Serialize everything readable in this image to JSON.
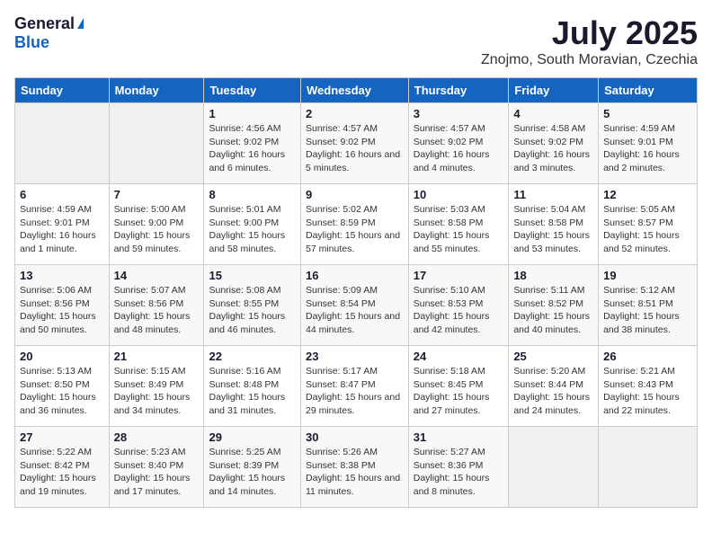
{
  "logo": {
    "general": "General",
    "blue": "Blue"
  },
  "title": "July 2025",
  "subtitle": "Znojmo, South Moravian, Czechia",
  "days_of_week": [
    "Sunday",
    "Monday",
    "Tuesday",
    "Wednesday",
    "Thursday",
    "Friday",
    "Saturday"
  ],
  "weeks": [
    [
      {
        "day": "",
        "sunrise": "",
        "sunset": "",
        "daylight": ""
      },
      {
        "day": "",
        "sunrise": "",
        "sunset": "",
        "daylight": ""
      },
      {
        "day": "1",
        "sunrise": "Sunrise: 4:56 AM",
        "sunset": "Sunset: 9:02 PM",
        "daylight": "Daylight: 16 hours and 6 minutes."
      },
      {
        "day": "2",
        "sunrise": "Sunrise: 4:57 AM",
        "sunset": "Sunset: 9:02 PM",
        "daylight": "Daylight: 16 hours and 5 minutes."
      },
      {
        "day": "3",
        "sunrise": "Sunrise: 4:57 AM",
        "sunset": "Sunset: 9:02 PM",
        "daylight": "Daylight: 16 hours and 4 minutes."
      },
      {
        "day": "4",
        "sunrise": "Sunrise: 4:58 AM",
        "sunset": "Sunset: 9:02 PM",
        "daylight": "Daylight: 16 hours and 3 minutes."
      },
      {
        "day": "5",
        "sunrise": "Sunrise: 4:59 AM",
        "sunset": "Sunset: 9:01 PM",
        "daylight": "Daylight: 16 hours and 2 minutes."
      }
    ],
    [
      {
        "day": "6",
        "sunrise": "Sunrise: 4:59 AM",
        "sunset": "Sunset: 9:01 PM",
        "daylight": "Daylight: 16 hours and 1 minute."
      },
      {
        "day": "7",
        "sunrise": "Sunrise: 5:00 AM",
        "sunset": "Sunset: 9:00 PM",
        "daylight": "Daylight: 15 hours and 59 minutes."
      },
      {
        "day": "8",
        "sunrise": "Sunrise: 5:01 AM",
        "sunset": "Sunset: 9:00 PM",
        "daylight": "Daylight: 15 hours and 58 minutes."
      },
      {
        "day": "9",
        "sunrise": "Sunrise: 5:02 AM",
        "sunset": "Sunset: 8:59 PM",
        "daylight": "Daylight: 15 hours and 57 minutes."
      },
      {
        "day": "10",
        "sunrise": "Sunrise: 5:03 AM",
        "sunset": "Sunset: 8:58 PM",
        "daylight": "Daylight: 15 hours and 55 minutes."
      },
      {
        "day": "11",
        "sunrise": "Sunrise: 5:04 AM",
        "sunset": "Sunset: 8:58 PM",
        "daylight": "Daylight: 15 hours and 53 minutes."
      },
      {
        "day": "12",
        "sunrise": "Sunrise: 5:05 AM",
        "sunset": "Sunset: 8:57 PM",
        "daylight": "Daylight: 15 hours and 52 minutes."
      }
    ],
    [
      {
        "day": "13",
        "sunrise": "Sunrise: 5:06 AM",
        "sunset": "Sunset: 8:56 PM",
        "daylight": "Daylight: 15 hours and 50 minutes."
      },
      {
        "day": "14",
        "sunrise": "Sunrise: 5:07 AM",
        "sunset": "Sunset: 8:56 PM",
        "daylight": "Daylight: 15 hours and 48 minutes."
      },
      {
        "day": "15",
        "sunrise": "Sunrise: 5:08 AM",
        "sunset": "Sunset: 8:55 PM",
        "daylight": "Daylight: 15 hours and 46 minutes."
      },
      {
        "day": "16",
        "sunrise": "Sunrise: 5:09 AM",
        "sunset": "Sunset: 8:54 PM",
        "daylight": "Daylight: 15 hours and 44 minutes."
      },
      {
        "day": "17",
        "sunrise": "Sunrise: 5:10 AM",
        "sunset": "Sunset: 8:53 PM",
        "daylight": "Daylight: 15 hours and 42 minutes."
      },
      {
        "day": "18",
        "sunrise": "Sunrise: 5:11 AM",
        "sunset": "Sunset: 8:52 PM",
        "daylight": "Daylight: 15 hours and 40 minutes."
      },
      {
        "day": "19",
        "sunrise": "Sunrise: 5:12 AM",
        "sunset": "Sunset: 8:51 PM",
        "daylight": "Daylight: 15 hours and 38 minutes."
      }
    ],
    [
      {
        "day": "20",
        "sunrise": "Sunrise: 5:13 AM",
        "sunset": "Sunset: 8:50 PM",
        "daylight": "Daylight: 15 hours and 36 minutes."
      },
      {
        "day": "21",
        "sunrise": "Sunrise: 5:15 AM",
        "sunset": "Sunset: 8:49 PM",
        "daylight": "Daylight: 15 hours and 34 minutes."
      },
      {
        "day": "22",
        "sunrise": "Sunrise: 5:16 AM",
        "sunset": "Sunset: 8:48 PM",
        "daylight": "Daylight: 15 hours and 31 minutes."
      },
      {
        "day": "23",
        "sunrise": "Sunrise: 5:17 AM",
        "sunset": "Sunset: 8:47 PM",
        "daylight": "Daylight: 15 hours and 29 minutes."
      },
      {
        "day": "24",
        "sunrise": "Sunrise: 5:18 AM",
        "sunset": "Sunset: 8:45 PM",
        "daylight": "Daylight: 15 hours and 27 minutes."
      },
      {
        "day": "25",
        "sunrise": "Sunrise: 5:20 AM",
        "sunset": "Sunset: 8:44 PM",
        "daylight": "Daylight: 15 hours and 24 minutes."
      },
      {
        "day": "26",
        "sunrise": "Sunrise: 5:21 AM",
        "sunset": "Sunset: 8:43 PM",
        "daylight": "Daylight: 15 hours and 22 minutes."
      }
    ],
    [
      {
        "day": "27",
        "sunrise": "Sunrise: 5:22 AM",
        "sunset": "Sunset: 8:42 PM",
        "daylight": "Daylight: 15 hours and 19 minutes."
      },
      {
        "day": "28",
        "sunrise": "Sunrise: 5:23 AM",
        "sunset": "Sunset: 8:40 PM",
        "daylight": "Daylight: 15 hours and 17 minutes."
      },
      {
        "day": "29",
        "sunrise": "Sunrise: 5:25 AM",
        "sunset": "Sunset: 8:39 PM",
        "daylight": "Daylight: 15 hours and 14 minutes."
      },
      {
        "day": "30",
        "sunrise": "Sunrise: 5:26 AM",
        "sunset": "Sunset: 8:38 PM",
        "daylight": "Daylight: 15 hours and 11 minutes."
      },
      {
        "day": "31",
        "sunrise": "Sunrise: 5:27 AM",
        "sunset": "Sunset: 8:36 PM",
        "daylight": "Daylight: 15 hours and 8 minutes."
      },
      {
        "day": "",
        "sunrise": "",
        "sunset": "",
        "daylight": ""
      },
      {
        "day": "",
        "sunrise": "",
        "sunset": "",
        "daylight": ""
      }
    ]
  ]
}
